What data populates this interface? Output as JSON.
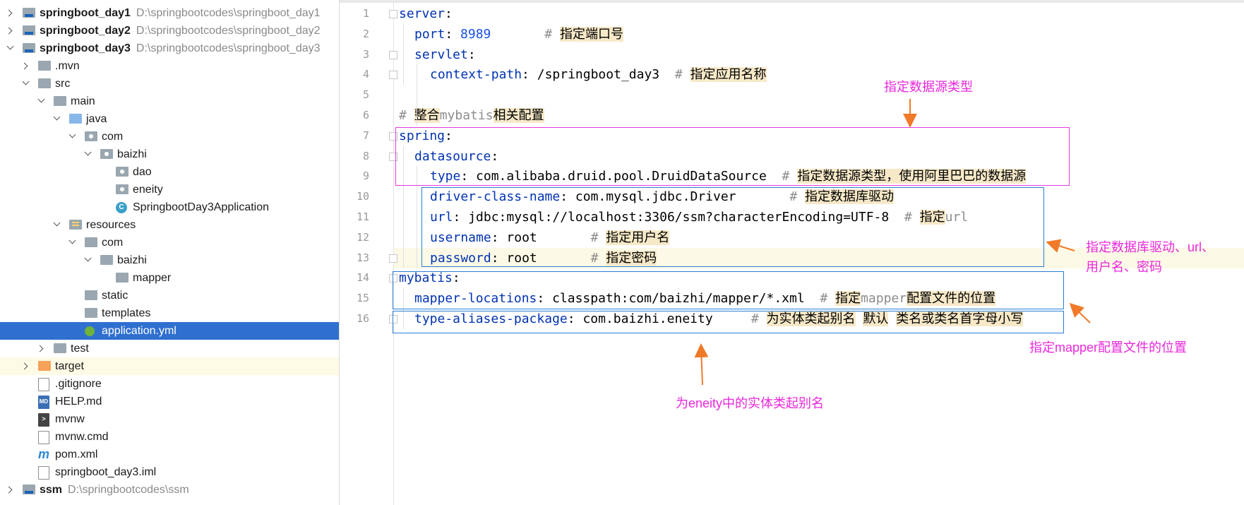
{
  "tree": [
    {
      "label": "springboot_day1",
      "path": "D:\\springbootcodes\\springboot_day1",
      "bold": true
    },
    {
      "label": "springboot_day2",
      "path": "D:\\springbootcodes\\springboot_day2",
      "bold": true
    },
    {
      "label": "springboot_day3",
      "path": "D:\\springbootcodes\\springboot_day3",
      "bold": true
    },
    {
      "label": ".mvn"
    },
    {
      "label": "src"
    },
    {
      "label": "main"
    },
    {
      "label": "java"
    },
    {
      "label": "com"
    },
    {
      "label": "baizhi"
    },
    {
      "label": "dao"
    },
    {
      "label": "eneity"
    },
    {
      "label": "SpringbootDay3Application"
    },
    {
      "label": "resources"
    },
    {
      "label": "com"
    },
    {
      "label": "baizhi"
    },
    {
      "label": "mapper"
    },
    {
      "label": "static"
    },
    {
      "label": "templates"
    },
    {
      "label": "application.yml"
    },
    {
      "label": "test"
    },
    {
      "label": "target"
    },
    {
      "label": ".gitignore"
    },
    {
      "label": "HELP.md"
    },
    {
      "label": "mvnw"
    },
    {
      "label": "mvnw.cmd"
    },
    {
      "label": "pom.xml"
    },
    {
      "label": "springboot_day3.iml"
    },
    {
      "label": "ssm",
      "path": "D:\\springbootcodes\\ssm",
      "bold": true
    }
  ],
  "code": [
    {
      "num": "1",
      "indent": 0,
      "key": "server",
      "sep": ":",
      "val": "",
      "num_val": "",
      "comment": "",
      "zh": ""
    },
    {
      "num": "2",
      "indent": 1,
      "key": "port",
      "sep": ":",
      "val": "",
      "num_val": "8989",
      "comment": "#",
      "zh": "指定端口号"
    },
    {
      "num": "3",
      "indent": 1,
      "key": "servlet",
      "sep": ":",
      "val": "",
      "num_val": "",
      "comment": "",
      "zh": ""
    },
    {
      "num": "4",
      "indent": 2,
      "key": "context-path",
      "sep": ":",
      "val": "/springboot_day3",
      "num_val": "",
      "comment": "#",
      "zh": "指定应用名称"
    },
    {
      "num": "5",
      "indent": 0,
      "key": "",
      "sep": "",
      "val": "",
      "num_val": "",
      "comment": "",
      "zh": ""
    },
    {
      "num": "6",
      "indent": 0,
      "key": "",
      "sep": "",
      "val": "",
      "num_val": "",
      "comment": "# ",
      "zh": "整合",
      "tail": "mybatis",
      "zh2": "相关配置"
    },
    {
      "num": "7",
      "indent": 0,
      "key": "spring",
      "sep": ":",
      "val": "",
      "num_val": "",
      "comment": "",
      "zh": ""
    },
    {
      "num": "8",
      "indent": 1,
      "key": "datasource",
      "sep": ":",
      "val": "",
      "num_val": "",
      "comment": "",
      "zh": ""
    },
    {
      "num": "9",
      "indent": 2,
      "key": "type",
      "sep": ":",
      "val": "com.alibaba.druid.pool.DruidDataSource",
      "num_val": "",
      "comment": "#",
      "zh": "指定数据源类型，使用阿里巴巴的数据源"
    },
    {
      "num": "10",
      "indent": 2,
      "key": "driver-class-name",
      "sep": ":",
      "val": "com.mysql.jdbc.Driver",
      "num_val": "",
      "comment": "#",
      "zh": "指定数据库驱动"
    },
    {
      "num": "11",
      "indent": 2,
      "key": "url",
      "sep": ":",
      "val": "jdbc:mysql://localhost:3306/ssm?characterEncoding=UTF-8",
      "num_val": "",
      "comment": "#",
      "zh": "指定",
      "tail": "url"
    },
    {
      "num": "12",
      "indent": 2,
      "key": "username",
      "sep": ":",
      "val": "root",
      "num_val": "",
      "comment": "#",
      "zh": "指定用户名"
    },
    {
      "num": "13",
      "indent": 2,
      "key": "password",
      "sep": ":",
      "val": "root",
      "num_val": "",
      "comment": "#",
      "zh": "指定密码"
    },
    {
      "num": "14",
      "indent": 0,
      "key": "mybatis",
      "sep": ":",
      "val": "",
      "num_val": "",
      "comment": "",
      "zh": ""
    },
    {
      "num": "15",
      "indent": 1,
      "key": "mapper-locations",
      "sep": ":",
      "val": "classpath:com/baizhi/mapper/*.xml",
      "num_val": "",
      "comment": "#",
      "zh": "指定",
      "tail": "mapper",
      "zh2": "配置文件的位置"
    },
    {
      "num": "16",
      "indent": 1,
      "key": "type-aliases-package",
      "sep": ":",
      "val": "com.baizhi.eneity",
      "num_val": "",
      "comment": "#",
      "zh": "为实体类起别名",
      "zh3": "默认",
      "zh4": "类名或类名首字母小写"
    }
  ],
  "annotations": {
    "datasource_type": "指定数据源类型",
    "driver_line1": "指定数据库驱动、url、",
    "driver_line2": "用户名、密码",
    "mapper": "指定mapper配置文件的位置",
    "alias": "为eneity中的实体类起别名"
  },
  "colors": {
    "key": "#0033b3",
    "number": "#1750eb",
    "comment": "#8c8c8c",
    "selection": "#2f6fd0",
    "annotation": "#ea27dc",
    "magenta_box": "#e63ae3",
    "blue_box": "#2a7fd4",
    "arrow": "#f07a2a"
  }
}
